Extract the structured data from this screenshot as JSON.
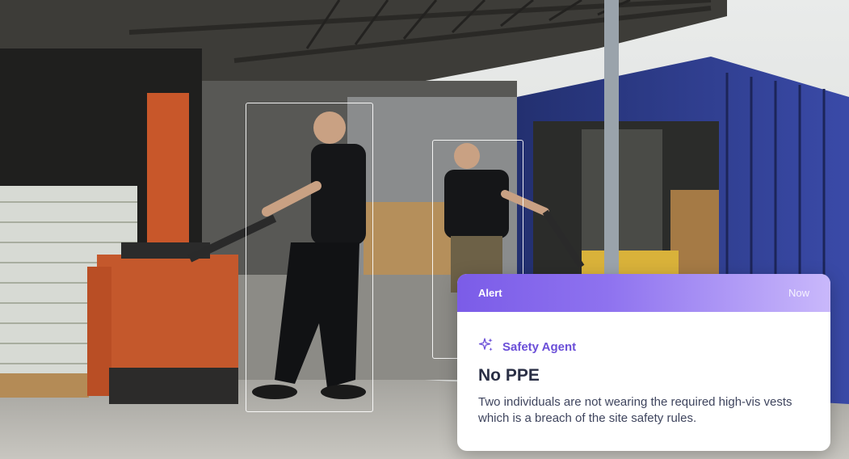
{
  "alert": {
    "label": "Alert",
    "time": "Now",
    "agent_name": "Safety Agent",
    "agent_icon": "sparkles-icon",
    "title": "No PPE",
    "description": "Two individuals are not wearing the required high-vis vests which is a breach of the site safety rules."
  },
  "detections": [
    {
      "label": "person"
    },
    {
      "label": "person"
    }
  ],
  "colors": {
    "accent": "#7b5ce8",
    "accent_text": "#6b4fd8",
    "title_text": "#2a2f45",
    "body_text": "#3f455e"
  }
}
